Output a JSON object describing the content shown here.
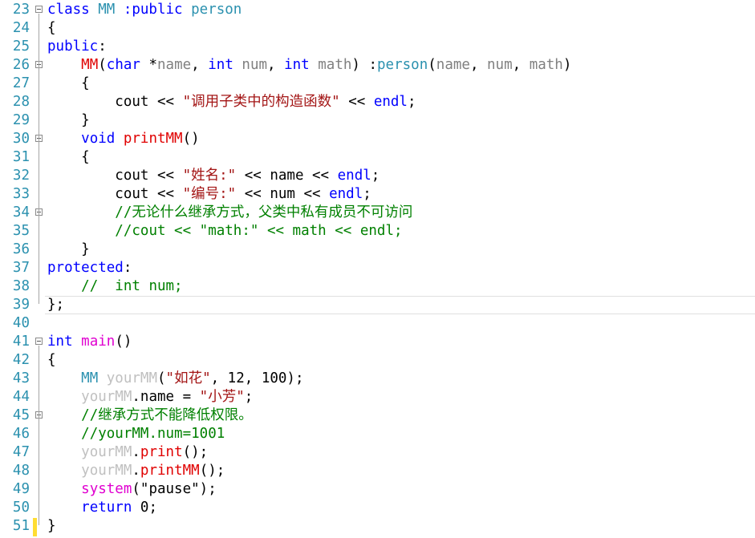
{
  "editor": {
    "lines": [
      {
        "n": "23",
        "fold": true,
        "tokens": [
          [
            "class ",
            "k"
          ],
          [
            "MM ",
            "t"
          ],
          [
            ":public ",
            "k"
          ],
          [
            "person",
            "t"
          ]
        ]
      },
      {
        "n": "24",
        "fold": false,
        "tokens": [
          [
            "{",
            "p"
          ]
        ]
      },
      {
        "n": "25",
        "fold": false,
        "tokens": [
          [
            "public",
            "k"
          ],
          [
            ":",
            "p"
          ]
        ]
      },
      {
        "n": "26",
        "fold": true,
        "tokens": [
          [
            "    ",
            "p"
          ],
          [
            "MM",
            "f"
          ],
          [
            "(",
            "p"
          ],
          [
            "char ",
            "k"
          ],
          [
            "*",
            "p"
          ],
          [
            "name",
            "v"
          ],
          [
            ", ",
            "p"
          ],
          [
            "int ",
            "k"
          ],
          [
            "num",
            "v"
          ],
          [
            ", ",
            "p"
          ],
          [
            "int ",
            "k"
          ],
          [
            "math",
            "v"
          ],
          [
            ") :",
            "p"
          ],
          [
            "person",
            "t"
          ],
          [
            "(",
            "p"
          ],
          [
            "name",
            "v"
          ],
          [
            ", ",
            "p"
          ],
          [
            "num",
            "v"
          ],
          [
            ", ",
            "p"
          ],
          [
            "math",
            "v"
          ],
          [
            ")",
            "p"
          ]
        ]
      },
      {
        "n": "27",
        "fold": false,
        "tokens": [
          [
            "    {",
            "p"
          ]
        ]
      },
      {
        "n": "28",
        "fold": false,
        "tokens": [
          [
            "        cout << ",
            "p"
          ],
          [
            "\"调用子类中的构造函数\"",
            "s"
          ],
          [
            " << ",
            "p"
          ],
          [
            "endl",
            "k"
          ],
          [
            ";",
            "p"
          ]
        ]
      },
      {
        "n": "29",
        "fold": false,
        "tokens": [
          [
            "    }",
            "p"
          ]
        ]
      },
      {
        "n": "30",
        "fold": true,
        "tokens": [
          [
            "    ",
            "p"
          ],
          [
            "void ",
            "k"
          ],
          [
            "printMM",
            "f"
          ],
          [
            "()",
            "p"
          ]
        ]
      },
      {
        "n": "31",
        "fold": false,
        "tokens": [
          [
            "    {",
            "p"
          ]
        ]
      },
      {
        "n": "32",
        "fold": false,
        "tokens": [
          [
            "        cout << ",
            "p"
          ],
          [
            "\"姓名:\"",
            "s"
          ],
          [
            " << name << ",
            "p"
          ],
          [
            "endl",
            "k"
          ],
          [
            ";",
            "p"
          ]
        ]
      },
      {
        "n": "33",
        "fold": false,
        "tokens": [
          [
            "        cout << ",
            "p"
          ],
          [
            "\"编号:\"",
            "s"
          ],
          [
            " << num << ",
            "p"
          ],
          [
            "endl",
            "k"
          ],
          [
            ";",
            "p"
          ]
        ]
      },
      {
        "n": "34",
        "fold": true,
        "tokens": [
          [
            "        ",
            "p"
          ],
          [
            "//无论什么继承方式，父类中私有成员不可访问",
            "c"
          ]
        ]
      },
      {
        "n": "35",
        "fold": false,
        "tokens": [
          [
            "        ",
            "p"
          ],
          [
            "//cout << \"math:\" << math << endl;",
            "c"
          ]
        ]
      },
      {
        "n": "36",
        "fold": false,
        "tokens": [
          [
            "    }",
            "p"
          ]
        ]
      },
      {
        "n": "37",
        "fold": false,
        "tokens": [
          [
            "protected",
            "k"
          ],
          [
            ":",
            "p"
          ]
        ]
      },
      {
        "n": "38",
        "fold": false,
        "tokens": [
          [
            "    ",
            "p"
          ],
          [
            "//  int num;",
            "c"
          ]
        ]
      },
      {
        "n": "39",
        "fold": false,
        "tokens": [
          [
            "};",
            "p"
          ]
        ]
      },
      {
        "n": "40",
        "fold": false,
        "tokens": []
      },
      {
        "n": "41",
        "fold": true,
        "tokens": [
          [
            "int ",
            "k"
          ],
          [
            "main",
            "fn"
          ],
          [
            "()",
            "p"
          ]
        ]
      },
      {
        "n": "42",
        "fold": false,
        "tokens": [
          [
            "{",
            "p"
          ]
        ]
      },
      {
        "n": "43",
        "fold": false,
        "tokens": [
          [
            "    ",
            "p"
          ],
          [
            "MM ",
            "t"
          ],
          [
            "yourMM",
            "l"
          ],
          [
            "(",
            "p"
          ],
          [
            "\"如花\"",
            "s"
          ],
          [
            ", 12, 100);",
            "p"
          ]
        ]
      },
      {
        "n": "44",
        "fold": false,
        "tokens": [
          [
            "    ",
            "p"
          ],
          [
            "yourMM",
            "l"
          ],
          [
            ".name = ",
            "p"
          ],
          [
            "\"小芳\"",
            "s"
          ],
          [
            ";",
            "p"
          ]
        ]
      },
      {
        "n": "45",
        "fold": true,
        "tokens": [
          [
            "    ",
            "p"
          ],
          [
            "//继承方式不能降低权限。",
            "c"
          ]
        ]
      },
      {
        "n": "46",
        "fold": false,
        "tokens": [
          [
            "    ",
            "p"
          ],
          [
            "//yourMM.num=1001",
            "c"
          ]
        ]
      },
      {
        "n": "47",
        "fold": false,
        "tokens": [
          [
            "    ",
            "p"
          ],
          [
            "yourMM",
            "l"
          ],
          [
            ".",
            "p"
          ],
          [
            "print",
            "f"
          ],
          [
            "();",
            "p"
          ]
        ]
      },
      {
        "n": "48",
        "fold": false,
        "tokens": [
          [
            "    ",
            "p"
          ],
          [
            "yourMM",
            "l"
          ],
          [
            ".",
            "p"
          ],
          [
            "printMM",
            "f"
          ],
          [
            "();",
            "p"
          ]
        ]
      },
      {
        "n": "49",
        "fold": false,
        "tokens": [
          [
            "    ",
            "p"
          ],
          [
            "system",
            "fn"
          ],
          [
            "(\"pause\");",
            "p"
          ]
        ]
      },
      {
        "n": "50",
        "fold": false,
        "tokens": [
          [
            "    ",
            "p"
          ],
          [
            "return ",
            "k"
          ],
          [
            "0;",
            "p"
          ]
        ]
      },
      {
        "n": "51",
        "fold": false,
        "tokens": [
          [
            "}",
            "p"
          ]
        ]
      }
    ]
  }
}
